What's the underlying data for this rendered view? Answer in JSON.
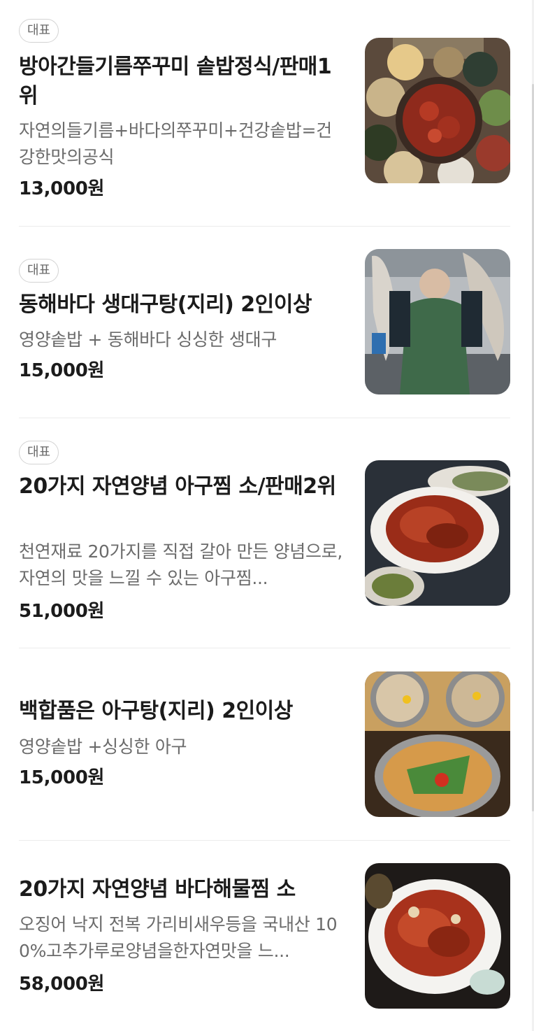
{
  "menu": {
    "items": [
      {
        "badge": "대표",
        "name": "방아간들기름쭈꾸미 솥밥정식/판매1위",
        "description": "자연의들기름+바다의쭈꾸미+건강솥밥=건강한맛의공식",
        "price": "13,000원",
        "image_icon": "food-photo-icon"
      },
      {
        "badge": "대표",
        "name": "동해바다 생대구탕(지리) 2인이상",
        "description": "영양솥밥 + 동해바다 싱싱한 생대구",
        "price": "15,000원",
        "image_icon": "fish-photo-icon"
      },
      {
        "badge": "대표",
        "name": "20가지 자연양념 아구찜 소/판매2위",
        "description": "천연재료 20가지를 직접 갈아 만든 양념으로, 자연의 맛을 느낄 수 있는 아구찜...",
        "price": "51,000원",
        "image_icon": "food-photo-icon"
      },
      {
        "badge": "",
        "name": "백합품은 아구탕(지리) 2인이상",
        "description": "영양솥밥 +싱싱한 아구",
        "price": "15,000원",
        "image_icon": "food-photo-icon"
      },
      {
        "badge": "",
        "name": "20가지 자연양념 바다해물찜 소",
        "description": "오징어 낙지 전복 가리비새우등을 국내산 100%고추가루로양념을한자연맛을 느...",
        "price": "58,000원",
        "image_icon": "food-photo-icon"
      }
    ]
  },
  "colors": {
    "text_primary": "#1b1b1b",
    "text_secondary": "#6b6b6b",
    "badge_border": "#d3d3d3",
    "divider": "#ececec"
  }
}
